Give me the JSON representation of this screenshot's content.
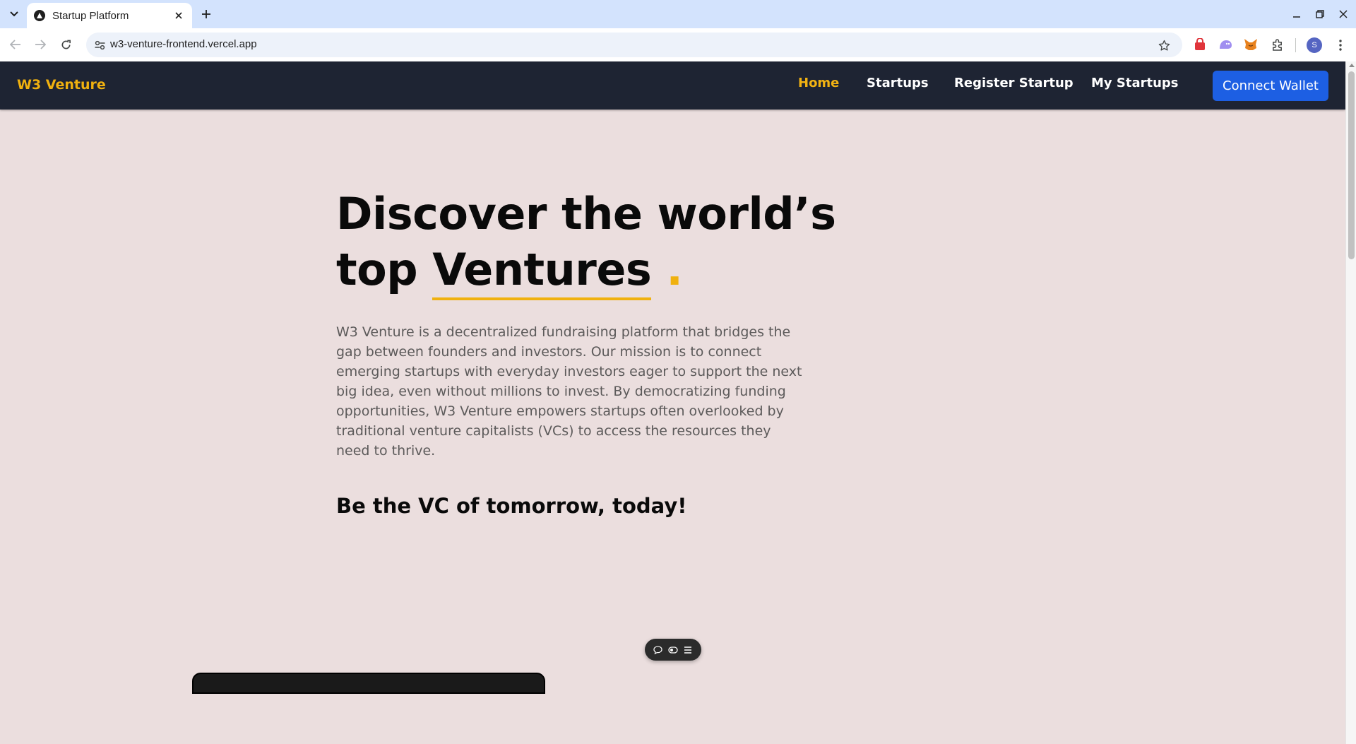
{
  "browser": {
    "tab_title": "Startup Platform",
    "url": "w3-venture-frontend.vercel.app",
    "profile_initial": "S",
    "icons": {
      "tab_list": "chevron-down-icon",
      "close_tab": "close-icon",
      "new_tab": "plus-icon",
      "back": "arrow-left-icon",
      "forward": "arrow-right-icon",
      "reload": "reload-icon",
      "site_info": "tune-icon",
      "bookmark": "star-icon",
      "menu": "kebab-menu-icon"
    }
  },
  "site": {
    "brand": "W3 Venture",
    "nav": {
      "home": "Home",
      "startups": "Startups",
      "register": "Register Startup",
      "my_startups": "My Startups"
    },
    "connect_button": "Connect Wallet",
    "colors": {
      "nav_bg": "#1e2433",
      "accent": "#f0b10f",
      "button": "#1d5fe3",
      "page_bg": "#ebdede"
    }
  },
  "hero": {
    "title_line1": "Discover the world’s",
    "title_word": "top",
    "title_accent": "Ventures",
    "title_dot": ".",
    "description": "W3 Venture is a decentralized fundraising platform that bridges the gap between founders and investors. Our mission is to connect emerging startups with everyday investors eager to support the next big idea, even without millions to invest. By democratizing funding opportunities, W3 Venture empowers startups often overlooked by traditional venture capitalists (VCs) to access the resources they need to thrive.",
    "tagline": "Be the VC of tomorrow, today!"
  }
}
